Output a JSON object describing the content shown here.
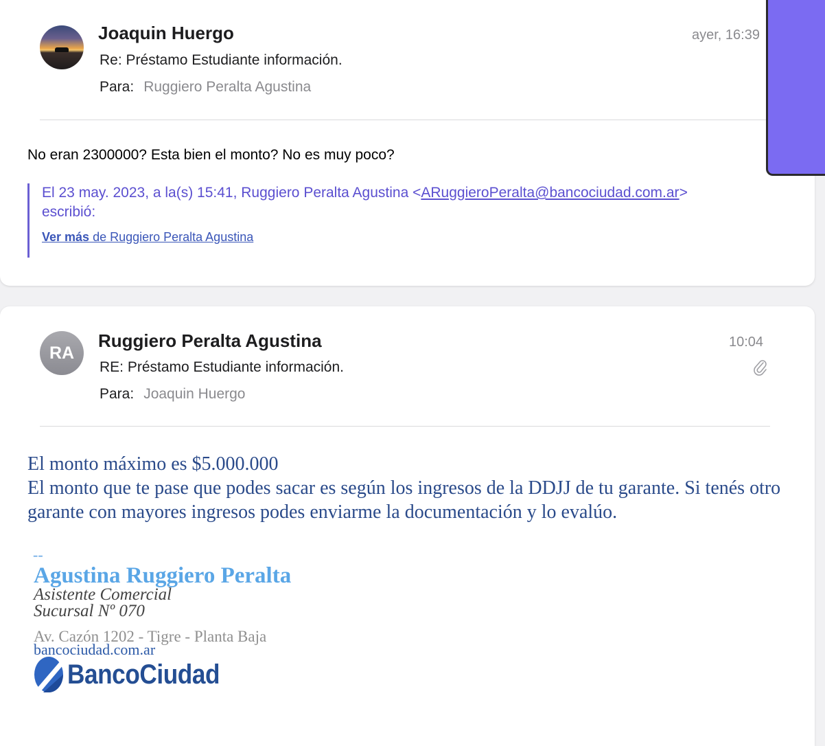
{
  "emails": [
    {
      "sender": "Joaquin Huergo",
      "subject": "Re: Préstamo Estudiante información.",
      "to_label": "Para:",
      "to": "Ruggiero Peralta Agustina",
      "time": "ayer, 16:39",
      "body": "No eran 2300000? Esta bien el monto? No es muy poco?",
      "quote": {
        "header_prefix": "El 23 may. 2023, a la(s) 15:41, Ruggiero Peralta Agustina <",
        "email": "ARuggieroPeralta@bancociudad.com.ar",
        "header_suffix": ">",
        "wrote": "escribió:",
        "more_bold": "Ver más",
        "more_rest": " de Ruggiero Peralta Agustina"
      }
    },
    {
      "sender": "Ruggiero Peralta Agustina",
      "avatar_initials": "RA",
      "subject": "RE: Préstamo Estudiante información.",
      "to_label": "Para:",
      "to": "Joaquin Huergo",
      "time": "10:04",
      "has_attachment_icon": "paperclip-icon",
      "body_lines": [
        "El monto máximo es $5.000.000",
        "El monto que te pase que podes sacar es según los ingresos de la DDJJ de tu garante. Si tenés otro garante con mayores ingresos podes enviarme la documentación y lo evalúo."
      ],
      "signature": {
        "dash": "--",
        "name": "Agustina Ruggiero Peralta",
        "role": "Asistente Comercial",
        "branch": "Sucursal Nº 070",
        "address": "Av. Cazón 1202 - Tigre - Planta Baja",
        "website": "bancociudad.com.ar",
        "bank_name": "BancoCiudad"
      }
    }
  ],
  "colors": {
    "quote_accent": "#6b5fd3",
    "reply_text": "#2a4a8a",
    "signature_name": "#5aa6e6",
    "bank_blue": "#244e93",
    "floating_window": "#7b6bf2"
  }
}
